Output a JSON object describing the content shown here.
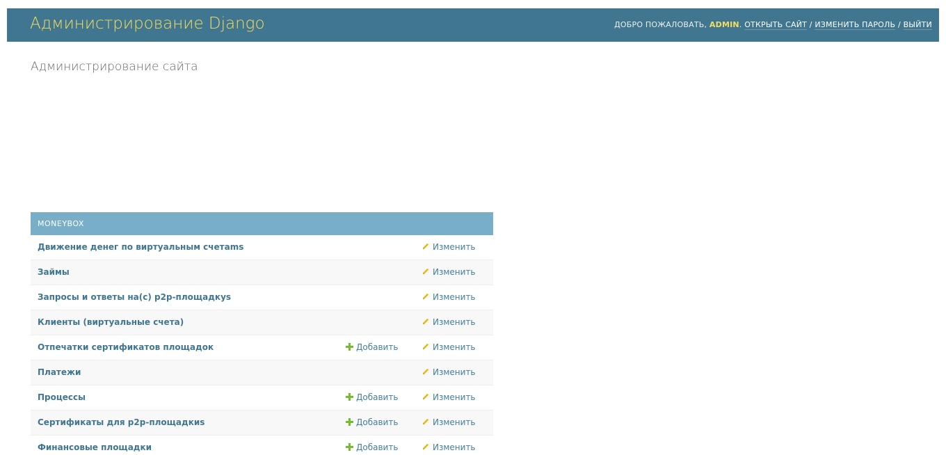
{
  "header": {
    "brand": "Администрирование Django",
    "welcome": "ДОБРО ПОЖАЛОВАТЬ,",
    "username": "ADMIN",
    "view_site": "ОТКРЫТЬ САЙТ",
    "change_password": "ИЗМЕНИТЬ ПАРОЛЬ",
    "logout": "ВЫЙТИ",
    "separator": "/"
  },
  "page_title": "Администрирование сайта",
  "module": {
    "caption": "MONEYBOX",
    "rows": [
      {
        "label": "Движение денег по виртуальным счетams",
        "add": "",
        "change": "Изменить"
      },
      {
        "label": "Займы",
        "add": "",
        "change": "Изменить"
      },
      {
        "label": "Запросы и ответы на(с) p2p-площадкуs",
        "add": "",
        "change": "Изменить"
      },
      {
        "label": "Клиенты (виртуальные счета)",
        "add": "",
        "change": "Изменить"
      },
      {
        "label": "Отпечатки сертификатов площадок",
        "add": "Добавить",
        "change": "Изменить"
      },
      {
        "label": "Платежи",
        "add": "",
        "change": "Изменить"
      },
      {
        "label": "Процессы",
        "add": "Добавить",
        "change": "Изменить"
      },
      {
        "label": "Сертификаты для p2p-площадкиs",
        "add": "Добавить",
        "change": "Изменить"
      },
      {
        "label": "Финансовые площадки",
        "add": "Добавить",
        "change": "Изменить"
      }
    ]
  },
  "colors": {
    "header_bg": "#417690",
    "brand": "#f5dd5d",
    "caption_bg": "#79aec8",
    "link": "#447e9b",
    "add_icon": "#70bf2b",
    "change_icon": "#efb80b"
  }
}
